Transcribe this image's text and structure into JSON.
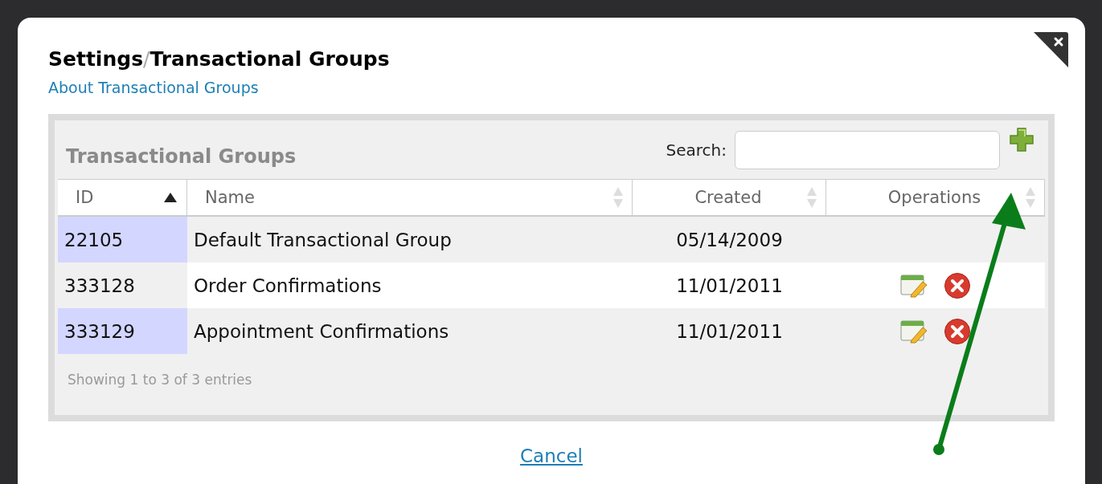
{
  "dialog": {
    "title": "Settings",
    "title_separator": "/",
    "title_current": "Transactional Groups",
    "about_link": "About Transactional Groups",
    "cancel_link": "Cancel"
  },
  "table": {
    "title": "Transactional Groups",
    "search": {
      "label": "Search:"
    },
    "columns": [
      {
        "label": "ID",
        "sorted": true
      },
      {
        "label": "Name",
        "sorted": false
      },
      {
        "label": "Created",
        "sorted": false
      },
      {
        "label": "Operations",
        "sorted": false
      }
    ],
    "rows": [
      {
        "id": "22105",
        "name": "Default Transactional Group",
        "created": "05/14/2009",
        "editable": false
      },
      {
        "id": "333128",
        "name": "Order Confirmations",
        "created": "11/01/2011",
        "editable": true
      },
      {
        "id": "333129",
        "name": "Appointment Confirmations",
        "created": "11/01/2011",
        "editable": true
      }
    ],
    "info": "Showing 1 to 3 of 3 entries"
  }
}
